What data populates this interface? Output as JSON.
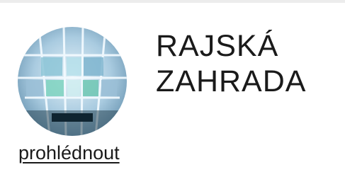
{
  "card": {
    "title_line1": "RAJSKÁ",
    "title_line2": "ZAHRADA",
    "link_label": "prohlédnout",
    "image_icon": "glass-ceiling-photo",
    "colors": {
      "text": "#1a1a1a",
      "glass_blue": "#6fa3c4",
      "glass_green": "#7fd4c0",
      "frame": "#cfe3ee"
    }
  }
}
